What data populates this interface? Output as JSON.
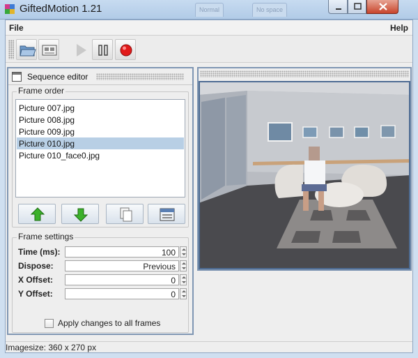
{
  "window": {
    "title": "GiftedMotion 1.21",
    "background_tabs": [
      "Normal",
      "No space"
    ]
  },
  "menu": {
    "file": "File",
    "help": "Help"
  },
  "toolbar": {
    "buttons": [
      "open-folder-icon",
      "settings-icon",
      "play-icon",
      "pause-icon",
      "record-icon"
    ]
  },
  "sequence_editor": {
    "title": "Sequence editor",
    "frame_order": {
      "title": "Frame order",
      "items": [
        {
          "label": "Picture 007.jpg",
          "selected": false
        },
        {
          "label": "Picture 008.jpg",
          "selected": false
        },
        {
          "label": "Picture 009.jpg",
          "selected": false
        },
        {
          "label": "Picture 010.jpg",
          "selected": true
        },
        {
          "label": "Picture 010_face0.jpg",
          "selected": false
        }
      ],
      "buttons": [
        "move-up-icon",
        "move-down-icon",
        "copy-icon",
        "delete-icon"
      ]
    },
    "frame_settings": {
      "title": "Frame settings",
      "time_label": "Time (ms):",
      "time_value": "100",
      "dispose_label": "Dispose:",
      "dispose_value": "Previous",
      "xoffset_label": "X Offset:",
      "xoffset_value": "0",
      "yoffset_label": "Y Offset:",
      "yoffset_value": "0",
      "apply_all_label": "Apply changes to all frames",
      "apply_all_checked": false
    }
  },
  "status": {
    "text": "Imagesize: 360 x 270 px"
  },
  "colors": {
    "selection": "#b8cfe5",
    "title_bar": "#c7dbf0",
    "record_red": "#e11a1a",
    "arrow_green": "#3bb12a"
  }
}
